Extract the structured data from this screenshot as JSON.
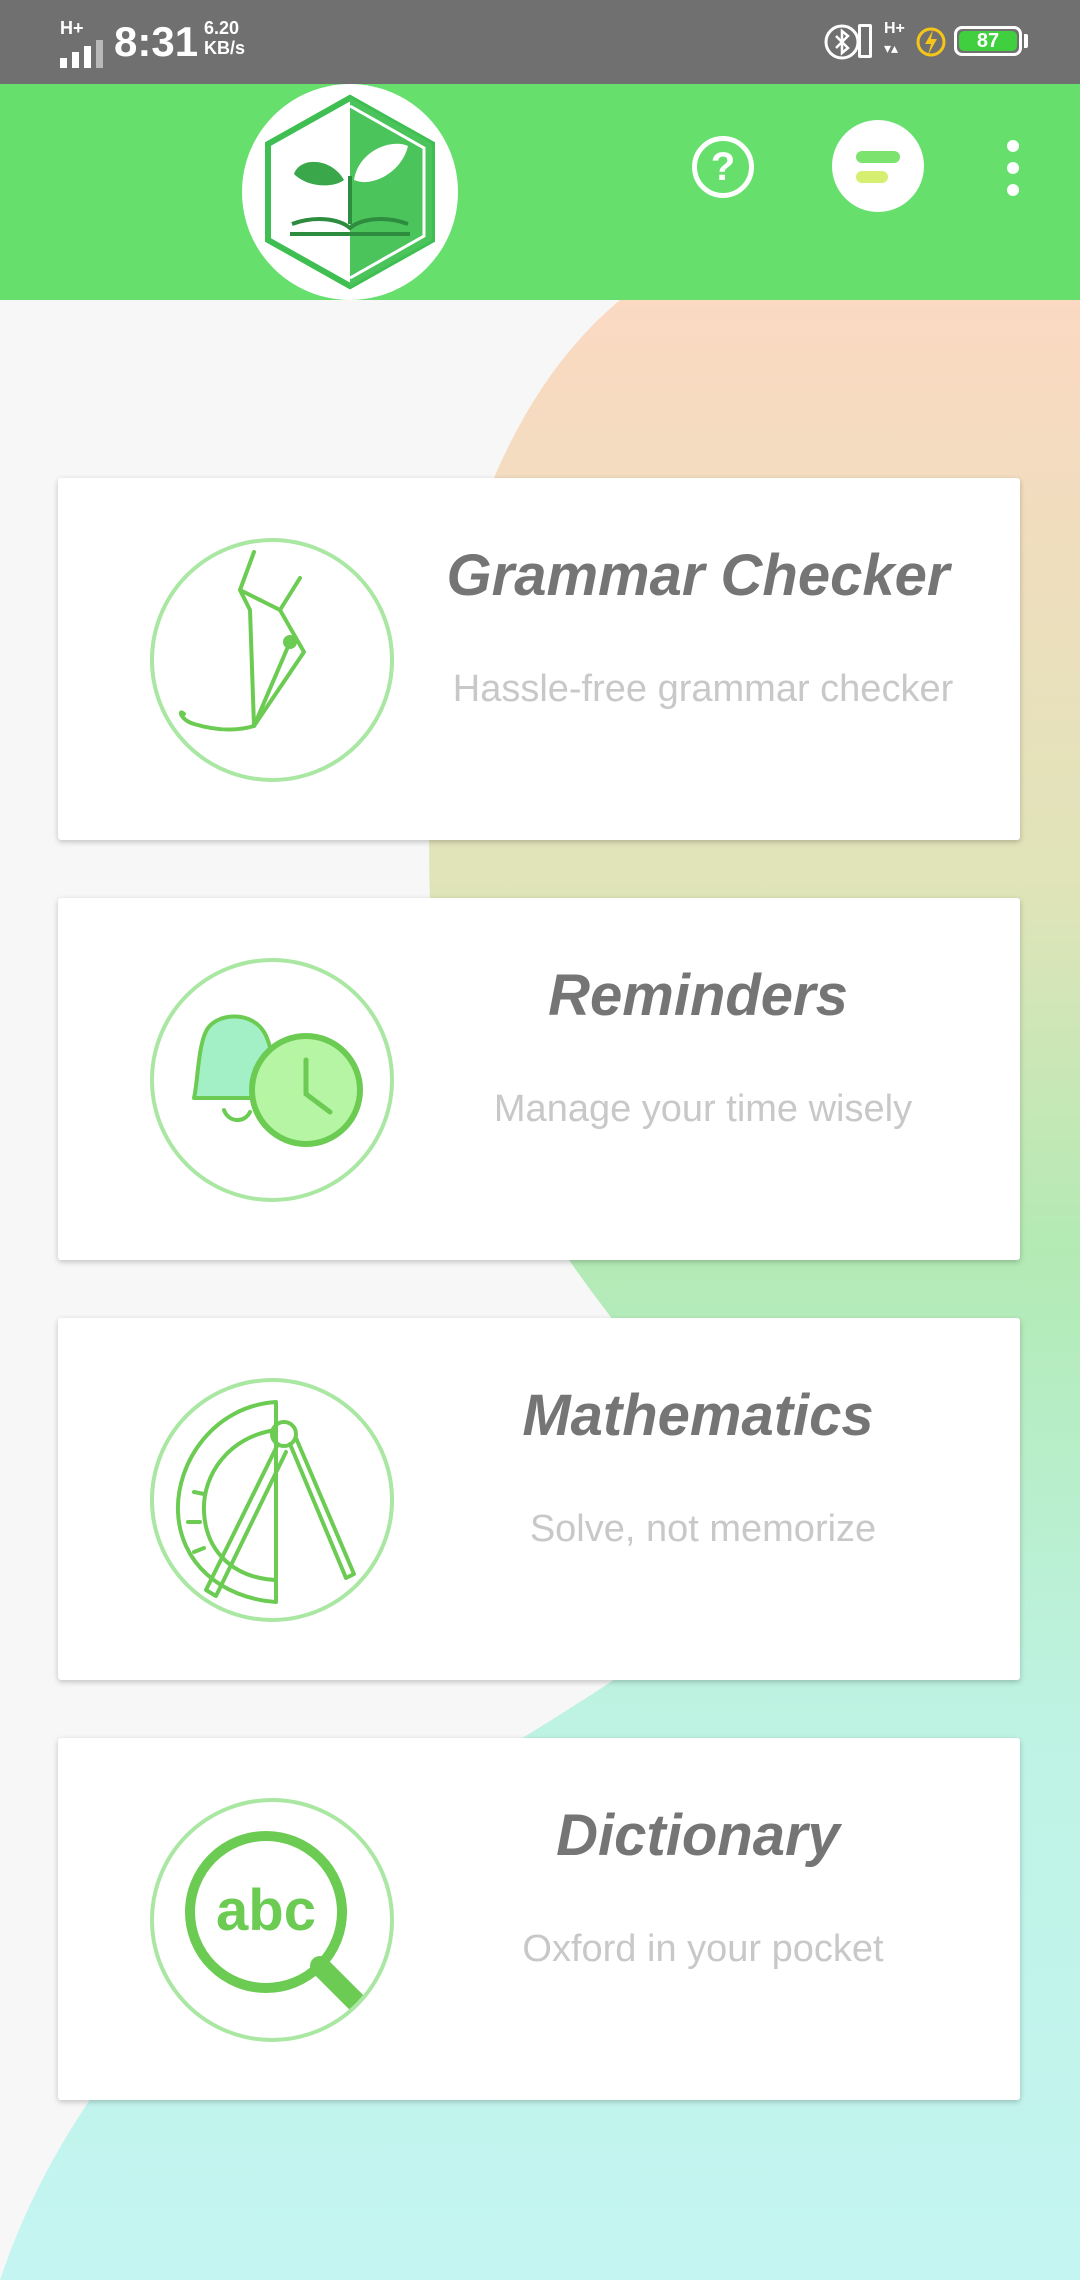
{
  "status_bar": {
    "network_type": "H+",
    "time": "8:31",
    "speed_value": "6.20",
    "speed_unit": "KB/s",
    "network_type_2": "H+",
    "battery_level": "87"
  },
  "app_bar": {
    "logo_icon": "plant-book-hexagon-logo",
    "help_icon": "question-circle-icon",
    "menu_icon": "menu-bars-icon",
    "overflow_icon": "more-vertical-icon",
    "color": "#66df6c"
  },
  "cards": [
    {
      "title": "Grammar Checker",
      "subtitle": "Hassle-free grammar checker",
      "icon": "fountain-pen-icon"
    },
    {
      "title": "Reminders",
      "subtitle": "Manage your time wisely",
      "icon": "bell-clock-icon"
    },
    {
      "title": "Mathematics",
      "subtitle": "Solve, not memorize",
      "icon": "compass-protractor-icon"
    },
    {
      "title": "Dictionary",
      "subtitle": "Oxford in your pocket",
      "icon": "abc-magnifier-icon",
      "icon_text": "abc"
    }
  ],
  "colors": {
    "accent_green": "#66df6c",
    "icon_green": "#6ccb52",
    "title_gray": "#757575",
    "subtitle_gray": "#c8c8c8"
  }
}
